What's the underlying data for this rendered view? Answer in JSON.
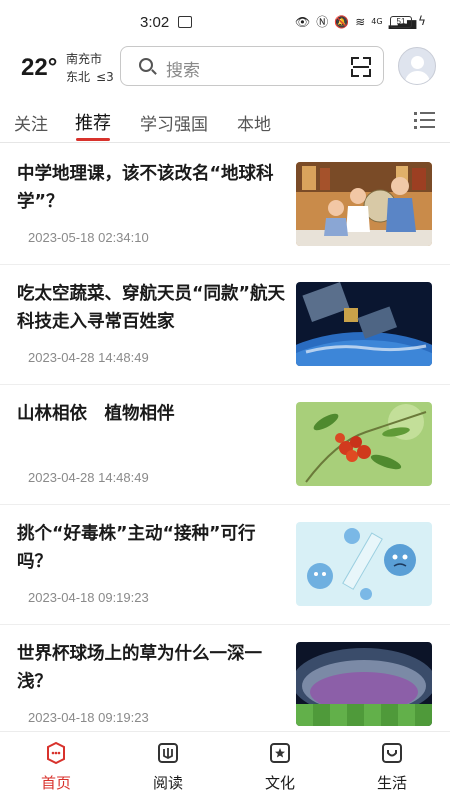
{
  "status_bar": {
    "time": "3:02",
    "network": "4G",
    "battery": "51"
  },
  "header": {
    "temperature": "22°",
    "city": "南充市",
    "wind_direction": "东北",
    "wind_level": "≤3",
    "search_placeholder": "搜索"
  },
  "tabs": [
    {
      "label": "关注",
      "active": false
    },
    {
      "label": "推荐",
      "active": true
    },
    {
      "label": "学习强国",
      "active": false
    },
    {
      "label": "本地",
      "active": false
    }
  ],
  "articles": [
    {
      "title": "中学地理课，该不该改名“地球科学”？",
      "date": "2023-05-18 02:34:10",
      "thumb": "classroom-globe"
    },
    {
      "title": "吃太空蔬菜、穿航天员“同款”航天科技走入寻常百姓家",
      "date": "2023-04-28 14:48:49",
      "thumb": "satellite-earth"
    },
    {
      "title": "山林相依　植物相伴",
      "date": "2023-04-28 14:48:49",
      "thumb": "red-berries"
    },
    {
      "title": "挑个“好毒株”主动“接种”可行吗？",
      "date": "2023-04-18 09:19:23",
      "thumb": "virus-cartoon"
    },
    {
      "title": "世界杯球场上的草为什么一深一浅？",
      "date": "2023-04-18 09:19:23",
      "thumb": "stadium"
    }
  ],
  "bottom_nav": [
    {
      "label": "首页",
      "icon": "home-icon",
      "active": true
    },
    {
      "label": "阅读",
      "icon": "book-icon",
      "active": false
    },
    {
      "label": "文化",
      "icon": "culture-icon",
      "active": false
    },
    {
      "label": "生活",
      "icon": "life-icon",
      "active": false
    }
  ],
  "colors": {
    "accent": "#d8322c",
    "text": "#1a1a1a",
    "muted": "#8a8a8a"
  }
}
